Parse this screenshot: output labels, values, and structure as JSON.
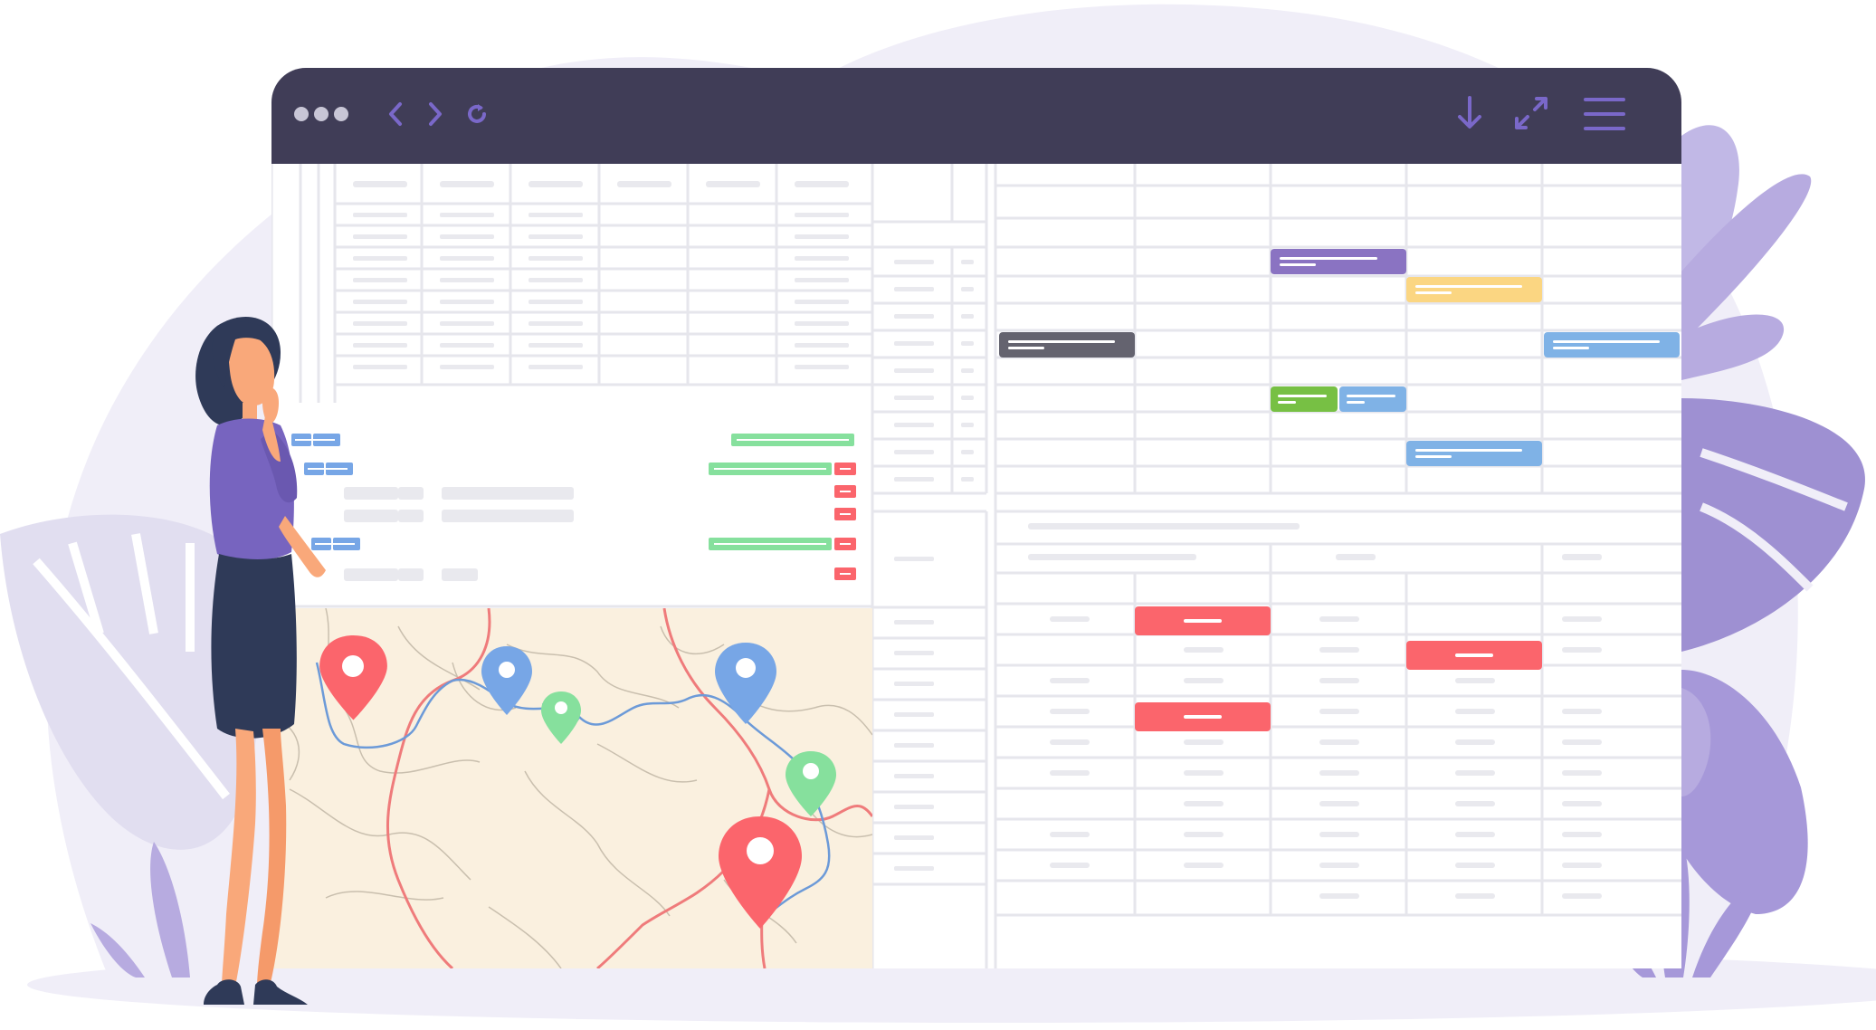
{
  "window": {
    "toolbar": {
      "dots_icon": "three-dots-icon",
      "back_icon": "chevron-left-icon",
      "forward_icon": "chevron-right-icon",
      "reload_icon": "reload-icon",
      "download_icon": "download-arrow-icon",
      "expand_icon": "expand-arrows-icon",
      "menu_icon": "hamburger-menu-icon"
    }
  },
  "colors": {
    "titlebar": "#403d57",
    "accent": "#7a68c9",
    "background_blob": "#f0eef8",
    "grid_line": "#e6e6ec",
    "placeholder": "#e9e9ee",
    "map_land": "#faf0df",
    "road": "#ef7b7b",
    "river": "#6c9ad8",
    "event_purple": "#8a73c2",
    "event_yellow": "#fbd682",
    "event_gray": "#64636f",
    "event_blue": "#7fb2e6",
    "event_green": "#77c044",
    "event_red": "#fb656c",
    "bar_green": "#86e09d",
    "bar_blue": "#77a6e6"
  },
  "map": {
    "pins": [
      {
        "color": "red",
        "icon": "map-pin-icon"
      },
      {
        "color": "blue",
        "icon": "map-pin-icon"
      },
      {
        "color": "green",
        "icon": "map-pin-icon"
      },
      {
        "color": "blue",
        "icon": "map-pin-icon"
      },
      {
        "color": "green",
        "icon": "map-pin-icon"
      },
      {
        "color": "red",
        "icon": "map-pin-icon"
      }
    ]
  },
  "illustration": {
    "figure": "woman-thinking",
    "foliage": "purple-tropical-leaves"
  }
}
